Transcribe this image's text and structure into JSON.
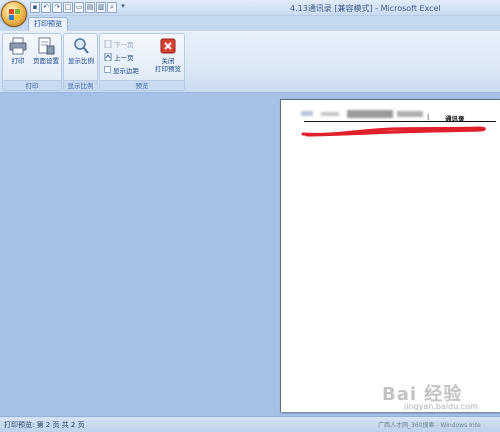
{
  "window": {
    "title": "4.13通讯录  [兼容模式] - Microsoft Excel"
  },
  "quick_access": [
    {
      "name": "save-icon",
      "glyph": "▪"
    },
    {
      "name": "undo-icon",
      "glyph": "↶"
    },
    {
      "name": "redo-icon",
      "glyph": "↷"
    },
    {
      "name": "new-icon",
      "glyph": "□"
    },
    {
      "name": "open-icon",
      "glyph": "▭"
    },
    {
      "name": "print-preview-icon",
      "glyph": "▤"
    },
    {
      "name": "quick-print-icon",
      "glyph": "▥"
    },
    {
      "name": "find-icon",
      "glyph": "⌕"
    }
  ],
  "ribbon": {
    "active_tab": "打印预览",
    "groups": {
      "print": {
        "label": "打印",
        "print_label": "打印",
        "page_setup_label": "页面设置"
      },
      "zoom": {
        "label": "显示比例",
        "zoom_label": "显示比例"
      },
      "preview": {
        "label": "预览",
        "next_page_label": "下一页",
        "prev_page_label": "上一页",
        "show_margins_label": "显示边距",
        "close_line1": "关闭",
        "close_line2": "打印预览"
      }
    }
  },
  "page_preview": {
    "title": "通讯录",
    "separator": "|"
  },
  "status_bar": {
    "text": "打印预览: 第 2 页 共 2 页",
    "taskbar_text": "广西人才网_360搜索 - Windows Inte"
  },
  "watermark": {
    "text": "Bai 经验",
    "sub": "jingyan.baidu.com"
  },
  "colors": {
    "accent": "#15428b",
    "workspace": "#a4c2e8",
    "annotation": "#e0202a"
  }
}
